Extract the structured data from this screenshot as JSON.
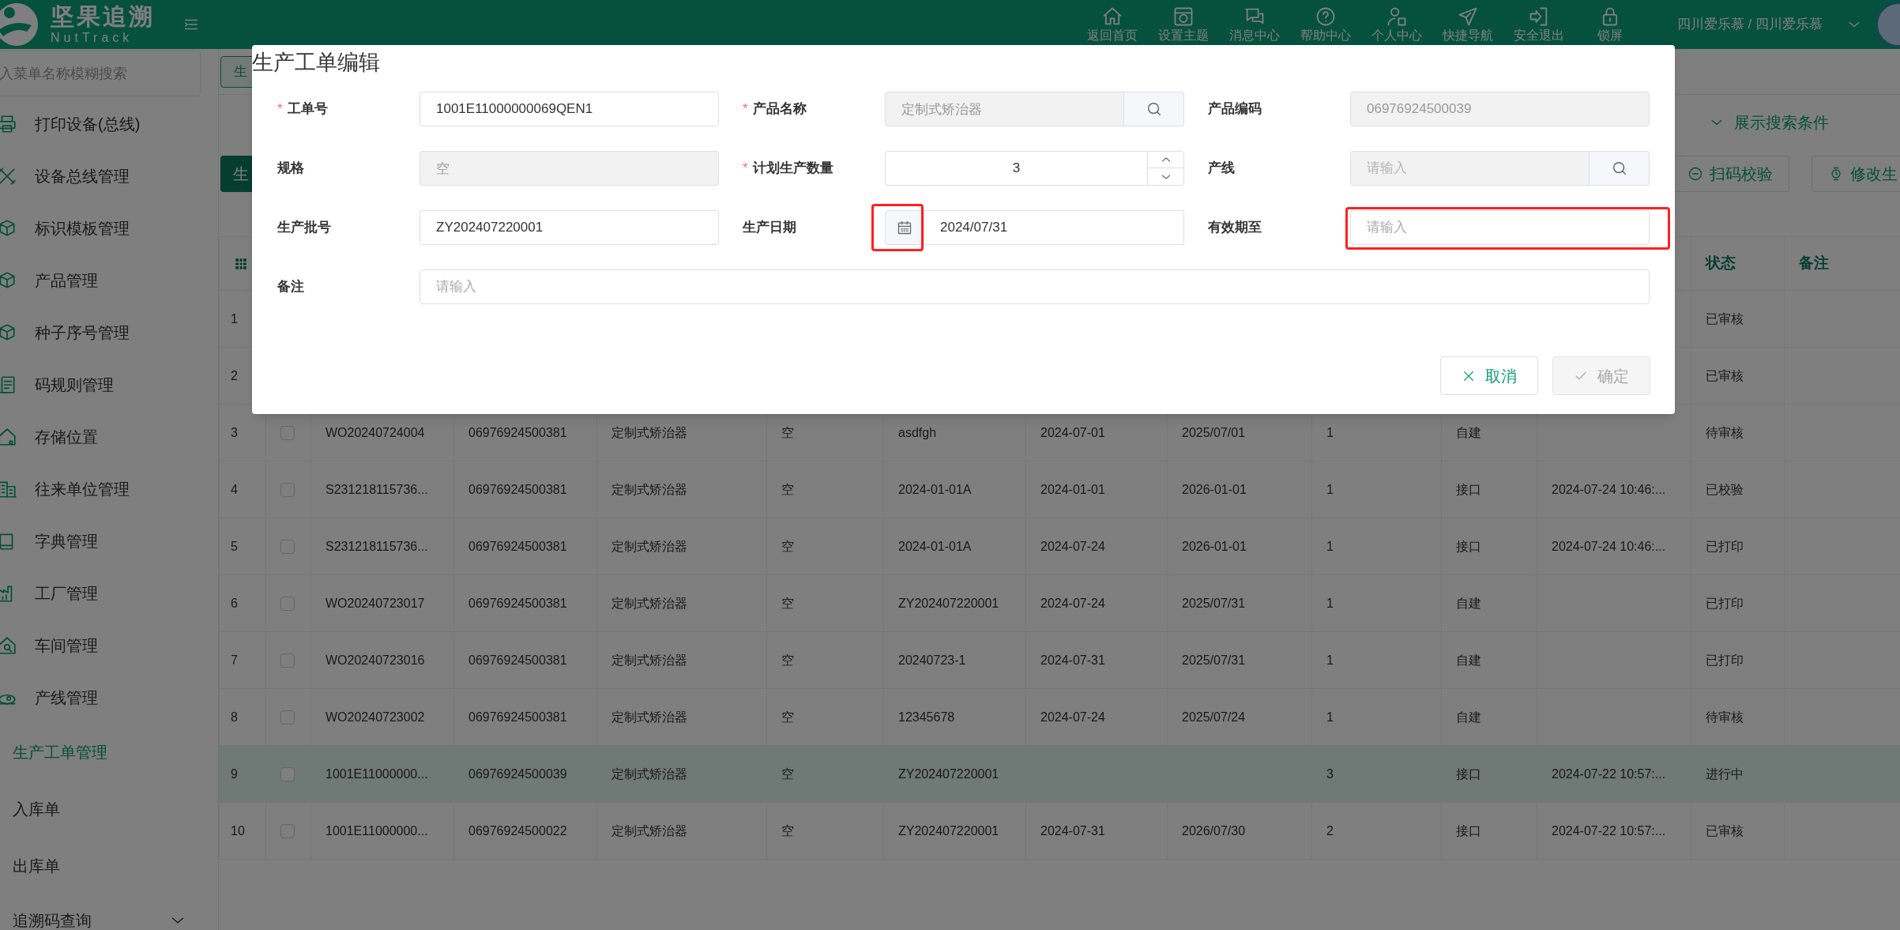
{
  "header": {
    "logo_title": "坚果追溯",
    "logo_subtitle": "NutTrack",
    "nav": [
      {
        "label": "返回首页"
      },
      {
        "label": "设置主题"
      },
      {
        "label": "消息中心"
      },
      {
        "label": "帮助中心"
      },
      {
        "label": "个人中心"
      },
      {
        "label": "快捷导航"
      },
      {
        "label": "安全退出"
      },
      {
        "label": "锁屏"
      }
    ],
    "user": "四川爱乐慕 / 四川爱乐慕"
  },
  "sidebar": {
    "search": {
      "placeholder": "入菜单名称模糊搜索"
    },
    "items": [
      {
        "label": "打印设备(总线)",
        "kind": "module",
        "selected": false
      },
      {
        "label": "设备总线管理",
        "kind": "module",
        "selected": false
      },
      {
        "label": "标识模板管理",
        "kind": "module",
        "selected": false
      },
      {
        "label": "产品管理",
        "kind": "module",
        "selected": false
      },
      {
        "label": "种子序号管理",
        "kind": "module",
        "selected": false
      },
      {
        "label": "码规则管理",
        "kind": "module",
        "selected": false
      },
      {
        "label": "存储位置",
        "kind": "module",
        "selected": false
      },
      {
        "label": "往来单位管理",
        "kind": "module",
        "selected": false
      },
      {
        "label": "字典管理",
        "kind": "module",
        "selected": false
      },
      {
        "label": "工厂管理",
        "kind": "module",
        "selected": false
      },
      {
        "label": "车间管理",
        "kind": "module",
        "selected": false
      },
      {
        "label": "产线管理",
        "kind": "module",
        "selected": false
      },
      {
        "label": "生产工单管理",
        "kind": "page",
        "selected": true
      },
      {
        "label": "入库单",
        "kind": "page",
        "selected": false
      },
      {
        "label": "出库单",
        "kind": "page",
        "selected": false
      },
      {
        "label": "追溯码查询",
        "kind": "group",
        "expanded": false,
        "selected": false
      }
    ]
  },
  "tabs": [
    {
      "label": "生",
      "selected": true
    }
  ],
  "toolbar": {
    "search_toggle": "展示搜索条件",
    "buttons": [
      {
        "label": "生",
        "kind": "primary"
      },
      {
        "label": "扫码校验",
        "kind": "scan"
      },
      {
        "label": "修改生",
        "kind": "edit"
      }
    ]
  },
  "table": {
    "headers": {
      "status": "状态",
      "remark": "备注"
    },
    "rows": [
      {
        "index": "1",
        "selected": false,
        "status": "已审核"
      },
      {
        "index": "2",
        "selected": false,
        "status": "已审核"
      },
      {
        "index": "3",
        "selected": false,
        "checked": false,
        "order_no": "WO20240724004",
        "product_code": "06976924500381",
        "product_name": "定制式矫治器",
        "spec": "空",
        "batch": "asdfgh",
        "production_date": "2024-07-01",
        "expiry_date": "2025/07/01",
        "quantity": "1",
        "source": "自建",
        "status": "待审核"
      },
      {
        "index": "4",
        "selected": false,
        "checked": false,
        "order_no": "S231218115736...",
        "product_code": "06976924500381",
        "product_name": "定制式矫治器",
        "spec": "空",
        "batch": "2024-01-01A",
        "production_date": "2024-01-01",
        "expiry_date": "2026-01-01",
        "quantity": "1",
        "source": "接口",
        "time": "2024-07-24 10:46:...",
        "status": "已校验"
      },
      {
        "index": "5",
        "selected": false,
        "checked": false,
        "order_no": "S231218115736...",
        "product_code": "06976924500381",
        "product_name": "定制式矫治器",
        "spec": "空",
        "batch": "2024-01-01A",
        "production_date": "2024-07-24",
        "expiry_date": "2026-01-01",
        "quantity": "1",
        "source": "接口",
        "time": "2024-07-24 10:46:...",
        "status": "已打印"
      },
      {
        "index": "6",
        "selected": false,
        "checked": false,
        "order_no": "WO20240723017",
        "product_code": "06976924500381",
        "product_name": "定制式矫治器",
        "spec": "空",
        "batch": "ZY202407220001",
        "production_date": "2024-07-24",
        "expiry_date": "2025/07/31",
        "quantity": "1",
        "source": "自建",
        "status": "已打印"
      },
      {
        "index": "7",
        "selected": false,
        "checked": false,
        "order_no": "WO20240723016",
        "product_code": "06976924500381",
        "product_name": "定制式矫治器",
        "spec": "空",
        "batch": "20240723-1",
        "production_date": "2024-07-31",
        "expiry_date": "2025/07/31",
        "quantity": "1",
        "source": "自建",
        "status": "已打印"
      },
      {
        "index": "8",
        "selected": false,
        "checked": false,
        "order_no": "WO20240723002",
        "product_code": "06976924500381",
        "product_name": "定制式矫治器",
        "spec": "空",
        "batch": "12345678",
        "production_date": "2024-07-24",
        "expiry_date": "2025/07/24",
        "quantity": "1",
        "source": "自建",
        "status": "待审核"
      },
      {
        "index": "9",
        "selected": true,
        "checked": false,
        "order_no": "1001E11000000...",
        "product_code": "06976924500039",
        "product_name": "定制式矫治器",
        "spec": "空",
        "batch": "ZY202407220001",
        "quantity": "3",
        "source": "接口",
        "time": "2024-07-22 10:57:...",
        "status": "进行中"
      },
      {
        "index": "10",
        "selected": false,
        "checked": false,
        "order_no": "1001E11000000...",
        "product_code": "06976924500022",
        "product_name": "定制式矫治器",
        "spec": "空",
        "batch": "ZY202407220001",
        "production_date": "2024-07-31",
        "expiry_date": "2026/07/30",
        "quantity": "2",
        "source": "接口",
        "time": "2024-07-22 10:57:...",
        "status": "已审核"
      }
    ]
  },
  "dialog": {
    "title": "生产工单编辑",
    "fields": [
      {
        "label": "工单号",
        "required_mark": "*",
        "kind": "text",
        "disabled": false,
        "value": "1001E11000000069QEN1"
      },
      {
        "label": "产品名称",
        "required_mark": "*",
        "kind": "search",
        "disabled": true,
        "value": "定制式矫治器"
      },
      {
        "label": "产品编码",
        "kind": "text",
        "disabled": true,
        "value": "06976924500039"
      },
      {
        "label": "规格",
        "kind": "text",
        "disabled": true,
        "value": "空"
      },
      {
        "label": "计划生产数量",
        "required_mark": "*",
        "kind": "number",
        "disabled": false,
        "value": "3"
      },
      {
        "label": "产线",
        "kind": "search",
        "disabled": true,
        "placeholder": "请输入"
      },
      {
        "label": "生产批号",
        "kind": "text",
        "disabled": false,
        "value": "ZY202407220001"
      },
      {
        "label": "生产日期",
        "kind": "date",
        "disabled": false,
        "value": "2024/07/31",
        "icon_highlighted": true
      },
      {
        "label": "有效期至",
        "kind": "text",
        "disabled": false,
        "placeholder": "请输入",
        "highlighted": true
      },
      {
        "label": "备注",
        "kind": "wide",
        "disabled": false,
        "placeholder": "请输入"
      }
    ],
    "buttons": [
      {
        "label": "取消",
        "kind": "cancel",
        "disabled": false
      },
      {
        "label": "确定",
        "kind": "confirm",
        "disabled": true
      }
    ]
  }
}
